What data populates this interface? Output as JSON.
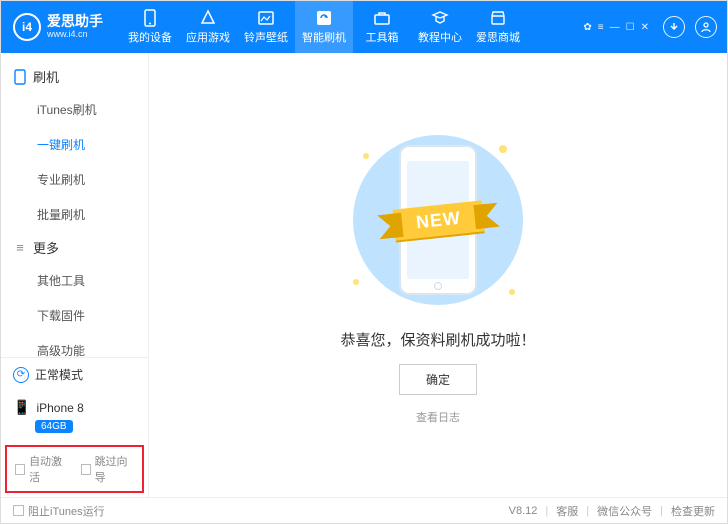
{
  "header": {
    "logo_badge": "i4",
    "logo_cn": "爱思助手",
    "logo_url": "www.i4.cn",
    "nav": [
      {
        "label": "我的设备"
      },
      {
        "label": "应用游戏"
      },
      {
        "label": "铃声壁纸"
      },
      {
        "label": "智能刷机"
      },
      {
        "label": "工具箱"
      },
      {
        "label": "教程中心"
      },
      {
        "label": "爱思商城"
      }
    ],
    "active_nav_index": 3
  },
  "sidebar": {
    "groups": [
      {
        "title": "刷机",
        "items": [
          {
            "label": "iTunes刷机"
          },
          {
            "label": "一键刷机"
          },
          {
            "label": "专业刷机"
          },
          {
            "label": "批量刷机"
          }
        ],
        "active_index": 1
      },
      {
        "title": "更多",
        "items": [
          {
            "label": "其他工具"
          },
          {
            "label": "下载固件"
          },
          {
            "label": "高级功能"
          }
        ],
        "active_index": -1
      }
    ],
    "mode_label": "正常模式",
    "device_name": "iPhone 8",
    "device_storage": "64GB",
    "checkbox_auto_activate": "自动激活",
    "checkbox_skip_wizard": "跳过向导"
  },
  "main": {
    "ribbon_text": "NEW",
    "success_text": "恭喜您，保资料刷机成功啦！",
    "ok_button": "确定",
    "view_log": "查看日志"
  },
  "footer": {
    "block_itunes": "阻止iTunes运行",
    "version": "V8.12",
    "links": [
      "客服",
      "微信公众号",
      "检查更新"
    ]
  }
}
